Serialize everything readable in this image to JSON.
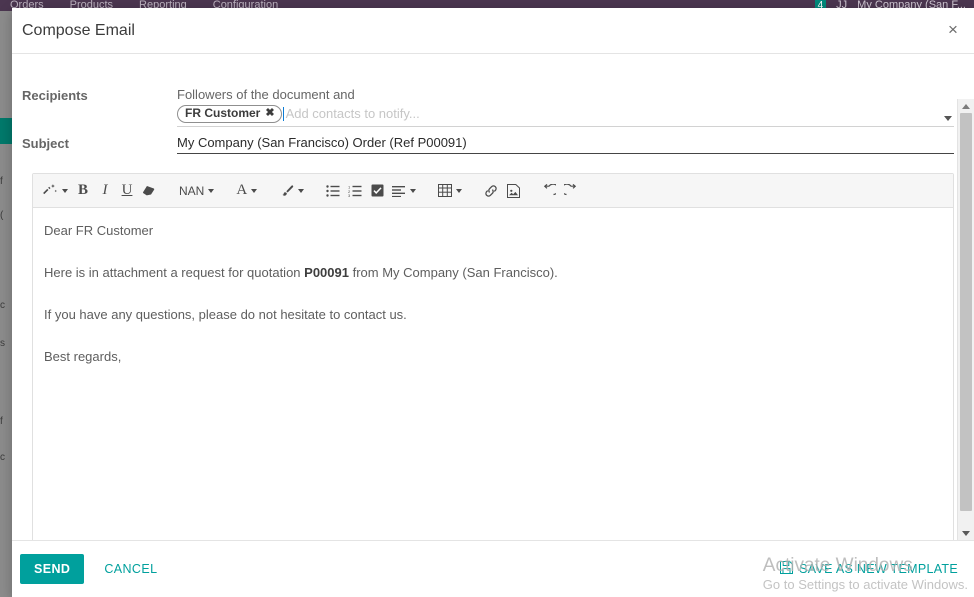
{
  "background": {
    "navbar": {
      "menu_items": [
        "Orders",
        "Products",
        "Reporting",
        "Configuration"
      ],
      "right_items": [
        "My Company (San F..."
      ],
      "badge": "4",
      "user_initials": "JJ",
      "color": "#4b3650"
    }
  },
  "modal": {
    "title": "Compose Email",
    "close_label": "×",
    "form": {
      "recipients": {
        "label": "Recipients",
        "static_text": "Followers of the document and",
        "tags": [
          {
            "name": "FR Customer",
            "remove_label": "✖"
          }
        ],
        "placeholder": "Add contacts to notify..."
      },
      "subject": {
        "label": "Subject",
        "value": "My Company (San Francisco) Order (Ref P00091)"
      }
    },
    "toolbar": {
      "buttons": [
        {
          "name": "style-magic-wand",
          "glyph": "magic",
          "caret": true,
          "title": "Style"
        },
        {
          "name": "bold",
          "glyph": "B",
          "caret": false,
          "title": "Bold"
        },
        {
          "name": "italic",
          "glyph": "I",
          "caret": false,
          "title": "Italic"
        },
        {
          "name": "underline",
          "glyph": "U",
          "caret": false,
          "title": "Underline"
        },
        {
          "name": "remove-format",
          "glyph": "eraser",
          "caret": false,
          "title": "Remove Font Style"
        },
        {
          "name": "font-size",
          "glyph": "NAN",
          "caret": true,
          "title": "Font Size"
        },
        {
          "name": "font-color",
          "glyph": "A",
          "caret": true,
          "title": "Font Color"
        },
        {
          "name": "background-color",
          "glyph": "brush",
          "caret": true,
          "title": "Background Color"
        },
        {
          "name": "unordered-list",
          "glyph": "ul",
          "caret": false,
          "title": "Unordered list"
        },
        {
          "name": "ordered-list",
          "glyph": "ol",
          "caret": false,
          "title": "Ordered list"
        },
        {
          "name": "checklist",
          "glyph": "checkbox",
          "caret": false,
          "title": "Checklist"
        },
        {
          "name": "paragraph-align",
          "glyph": "align",
          "caret": true,
          "title": "Paragraph"
        },
        {
          "name": "table",
          "glyph": "table",
          "caret": true,
          "title": "Table"
        },
        {
          "name": "insert-link",
          "glyph": "link",
          "caret": false,
          "title": "Insert Link"
        },
        {
          "name": "insert-image",
          "glyph": "image",
          "caret": false,
          "title": "Insert Image"
        },
        {
          "name": "undo",
          "glyph": "undo",
          "caret": false,
          "title": "Undo"
        },
        {
          "name": "redo",
          "glyph": "redo",
          "caret": false,
          "title": "Redo"
        }
      ]
    },
    "body": {
      "greeting": "Dear FR Customer",
      "para2_before": "Here is in attachment a request for quotation ",
      "para2_bold": "P00091",
      "para2_after": " from My Company (San Francisco).",
      "para3": "If you have any questions, please do not hesitate to contact us.",
      "signoff": "Best regards,"
    },
    "footer": {
      "send_label": "SEND",
      "cancel_label": "CANCEL",
      "save_template_label": "SAVE AS NEW TEMPLATE"
    }
  },
  "watermark": {
    "title": "Activate Windows",
    "subtitle": "Go to Settings to activate Windows."
  },
  "colors": {
    "accent_teal": "#00a09d",
    "navbar_purple": "#4b3650",
    "text_gray": "#5e5e5e"
  }
}
